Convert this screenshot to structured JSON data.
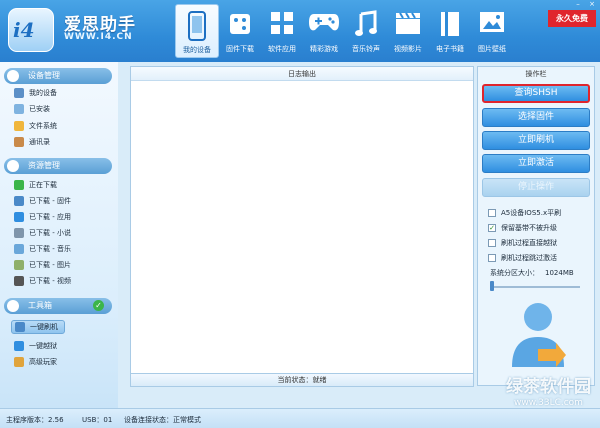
{
  "app": {
    "name": "爱思助手",
    "url": "WWW.I4.CN",
    "logo": "i4",
    "free_badge": "永久免费"
  },
  "nav": [
    {
      "label": "我的设备",
      "icon": "phone-icon",
      "active": true
    },
    {
      "label": "固件下载",
      "icon": "cube-icon"
    },
    {
      "label": "软件应用",
      "icon": "apps-grid-icon"
    },
    {
      "label": "精彩游戏",
      "icon": "gamepad-icon"
    },
    {
      "label": "音乐铃声",
      "icon": "music-note-icon"
    },
    {
      "label": "视频影片",
      "icon": "clapperboard-icon"
    },
    {
      "label": "电子书籍",
      "icon": "book-icon"
    },
    {
      "label": "图片壁纸",
      "icon": "picture-icon"
    }
  ],
  "sidebar": {
    "device_group": {
      "title": "设备管理",
      "items": [
        "我的设备",
        "已安装",
        "文件系统",
        "通讯录"
      ]
    },
    "resource_group": {
      "title": "资源管理",
      "items": [
        "正在下载",
        "已下载 - 固件",
        "已下载 - 应用",
        "已下载 - 小说",
        "已下载 - 音乐",
        "已下载 - 图片",
        "已下载 - 视频"
      ]
    },
    "tools_group": {
      "title": "工具箱",
      "items": [
        "一键刷机",
        "一键越狱",
        "高级玩家"
      ]
    }
  },
  "log": {
    "title": "日志输出",
    "status": "当前状态：就绪"
  },
  "ops": {
    "title": "操作栏",
    "buttons": [
      "查询SHSH",
      "选择固件",
      "立即刷机",
      "立即激活",
      "停止操作"
    ],
    "options": [
      {
        "label": "A5设备IOS5.x平刷",
        "checked": false
      },
      {
        "label": "保留基带不被升级",
        "checked": true
      },
      {
        "label": "刷机过程直接越狱",
        "checked": false
      },
      {
        "label": "刷机过程跳过激活",
        "checked": false
      }
    ],
    "partition_label": "系统分区大小：",
    "partition_value": "1024MB"
  },
  "statusbar": {
    "version": "主程序版本：2.56",
    "usb": "USB：01",
    "connection": "设备连接状态：正常模式"
  },
  "watermark": {
    "line1": "绿茶软件园",
    "line2": "www.33LC.com"
  },
  "colors": {
    "header": "#2f8bd8",
    "accent": "#2f8ee0",
    "selected_border": "#e0252d",
    "badge": "#e0252d"
  }
}
